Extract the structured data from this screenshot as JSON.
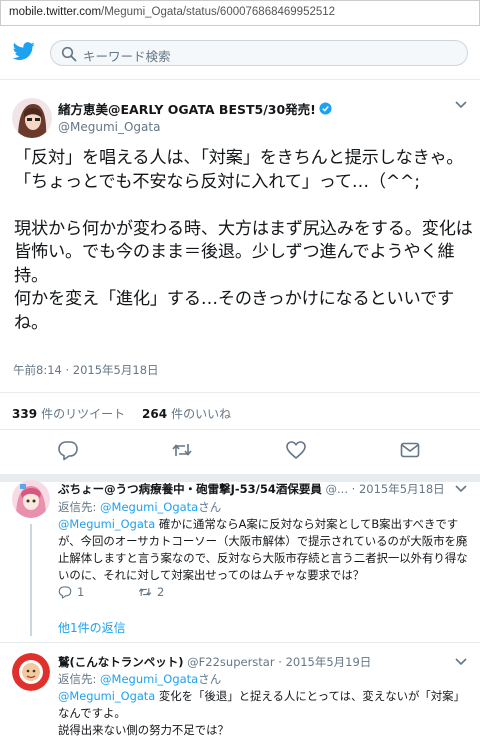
{
  "browser": {
    "url_host": "mobile.twitter.com",
    "url_path": "/Megumi_Ogata/status/600076868469952512"
  },
  "header": {
    "logo_icon": "twitter-bird-icon",
    "search_placeholder": "キーワード検索"
  },
  "tweet": {
    "author_name": "緒方恵美@EARLY OGATA BEST5/30発売!",
    "author_handle": "@Megumi_Ogata",
    "verified": true,
    "body": "「反対」を唱える人は、「対案」をきちんと提示しなきゃ。\n「ちょっとでも不安なら反対に入れて」って…（^^;\n\n現状から何かが変わる時、大方はまず尻込みをする。変化は皆怖い。でも今のまま＝後退。少しずつ進んでようやく維持。\n何かを変え「進化」する…そのきっかけになるといいですね。",
    "timestamp": "午前8:14 · 2015年5月18日",
    "retweets_count": "339",
    "retweets_label": "件のリツイート",
    "likes_count": "264",
    "likes_label": "件のいいね"
  },
  "actions": [
    "reply-icon",
    "retweet-icon",
    "like-icon",
    "message-icon"
  ],
  "replies": [
    {
      "name": "ぶちょー@うつ病療養中・砲雷撃J-53/54酒保要員",
      "handle": "@...",
      "date": "2015年5月18日",
      "reply_to_prefix": "返信先: ",
      "reply_to_handle": "@Megumi_Ogata",
      "reply_to_suffix": "さん",
      "mention": "@Megumi_Ogata",
      "text": " 確かに通常ならA案に反対なら対案としてB案出すべきですが、今回のオーサカトコーソー（大阪市解体）で提示されているのが大阪市を廃止解体しますと言う案なので、反対なら大阪市存続と言う二者択一以外有り得ないのに、それに対して対案出せってのはムチャな要求では？",
      "reply_count": "1",
      "retweet_count": "2",
      "more_replies": "他1件の返信"
    },
    {
      "name": "鷲(こんなトランペット)",
      "handle": "@F22superstar",
      "date": "2015年5月19日",
      "reply_to_prefix": "返信先: ",
      "reply_to_handle": "@Megumi_Ogata",
      "reply_to_suffix": "さん",
      "mention": "@Megumi_Ogata",
      "text": " 変化を「後退」と捉える人にとっては、変えないが「対案」なんですよ。\n説得出来ない側の努力不足では？"
    }
  ],
  "colors": {
    "twitter_blue": "#1da1f2",
    "secondary_text": "#657786",
    "divider": "#e6ecf0"
  }
}
